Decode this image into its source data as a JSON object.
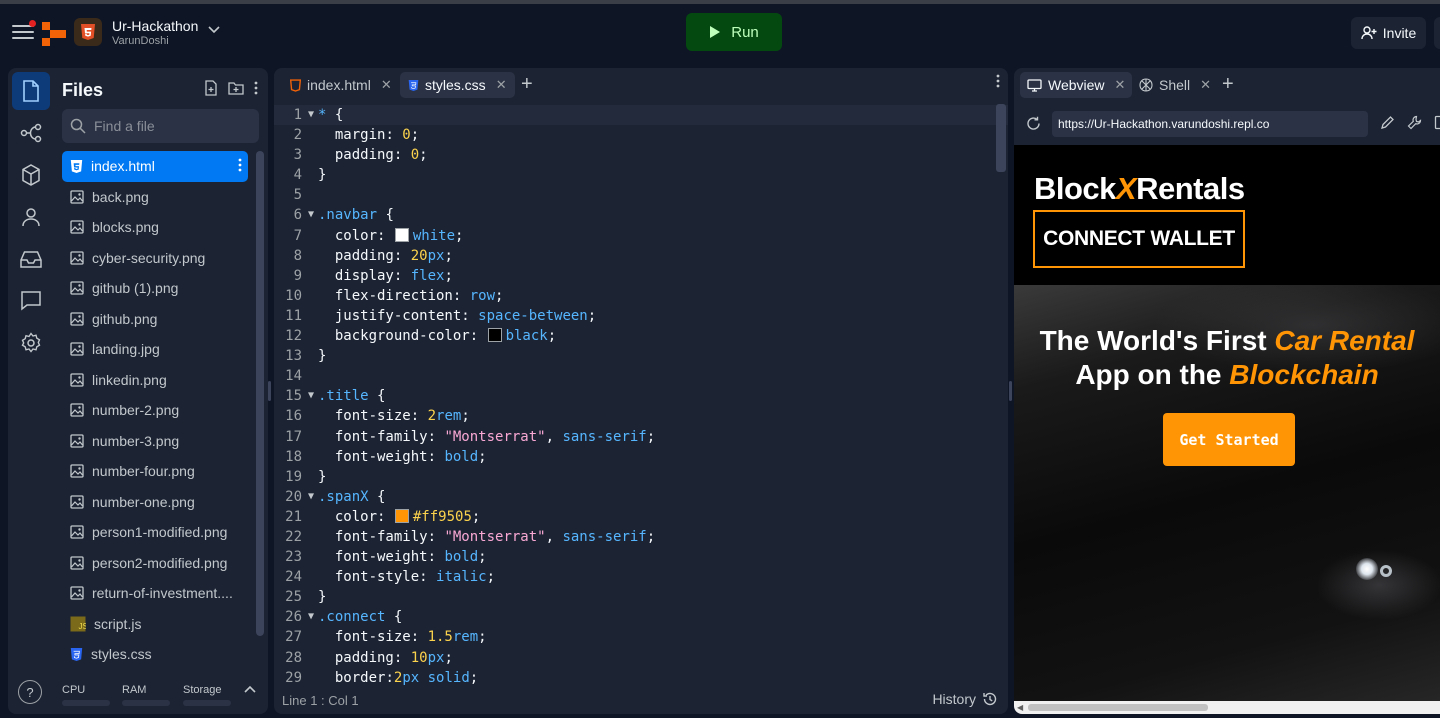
{
  "project": {
    "name": "Ur-Hackathon",
    "owner": "VarunDoshi"
  },
  "topbar": {
    "run_label": "Run",
    "invite_label": "Invite"
  },
  "files_panel": {
    "title": "Files",
    "search_placeholder": "Find a file",
    "files": [
      {
        "name": "index.html",
        "icon": "html-file-icon",
        "active": true
      },
      {
        "name": "back.png",
        "icon": "image-file-icon"
      },
      {
        "name": "blocks.png",
        "icon": "image-file-icon"
      },
      {
        "name": "cyber-security.png",
        "icon": "image-file-icon"
      },
      {
        "name": "github (1).png",
        "icon": "image-file-icon"
      },
      {
        "name": "github.png",
        "icon": "image-file-icon"
      },
      {
        "name": "landing.jpg",
        "icon": "image-file-icon"
      },
      {
        "name": "linkedin.png",
        "icon": "image-file-icon"
      },
      {
        "name": "number-2.png",
        "icon": "image-file-icon"
      },
      {
        "name": "number-3.png",
        "icon": "image-file-icon"
      },
      {
        "name": "number-four.png",
        "icon": "image-file-icon"
      },
      {
        "name": "number-one.png",
        "icon": "image-file-icon"
      },
      {
        "name": "person1-modified.png",
        "icon": "image-file-icon"
      },
      {
        "name": "person2-modified.png",
        "icon": "image-file-icon"
      },
      {
        "name": "return-of-investment....",
        "icon": "image-file-icon"
      },
      {
        "name": "script.js",
        "icon": "js-file-icon"
      },
      {
        "name": "styles.css",
        "icon": "css-file-icon"
      }
    ],
    "resources": {
      "cpu": "CPU",
      "ram": "RAM",
      "storage": "Storage"
    }
  },
  "editor": {
    "tabs": [
      {
        "label": "index.html",
        "icon": "html-file-icon",
        "active": false
      },
      {
        "label": "styles.css",
        "icon": "css-file-icon",
        "active": true
      }
    ],
    "status_position": "Line 1 : Col 1",
    "history_label": "History",
    "lines": [
      {
        "n": 1,
        "fold": true,
        "html": "<span class='t-sel'>*</span> {"
      },
      {
        "n": 2,
        "html": "  <span class='t-prop'>margin</span>: <span class='t-num'>0</span>;"
      },
      {
        "n": 3,
        "html": "  <span class='t-prop'>padding</span>: <span class='t-num'>0</span>;"
      },
      {
        "n": 4,
        "html": "}"
      },
      {
        "n": 5,
        "html": ""
      },
      {
        "n": 6,
        "fold": true,
        "html": "<span class='t-sel'>.navbar</span> {"
      },
      {
        "n": 7,
        "html": "  <span class='t-prop'>color</span>: <span class='swatch' style='background:#ffffff'></span><span class='t-kw'>white</span>;"
      },
      {
        "n": 8,
        "html": "  <span class='t-prop'>padding</span>: <span class='t-num'>20</span><span class='t-unit'>px</span>;"
      },
      {
        "n": 9,
        "html": "  <span class='t-prop'>display</span>: <span class='t-kw'>flex</span>;"
      },
      {
        "n": 10,
        "html": "  <span class='t-prop'>flex-direction</span>: <span class='t-kw'>row</span>;"
      },
      {
        "n": 11,
        "html": "  <span class='t-prop'>justify-content</span>: <span class='t-kw'>space-between</span>;"
      },
      {
        "n": 12,
        "html": "  <span class='t-prop'>background-color</span>: <span class='swatch' style='background:#000000'></span><span class='t-kw'>black</span>;"
      },
      {
        "n": 13,
        "html": "}"
      },
      {
        "n": 14,
        "html": ""
      },
      {
        "n": 15,
        "fold": true,
        "html": "<span class='t-sel'>.title</span> {"
      },
      {
        "n": 16,
        "html": "  <span class='t-prop'>font-size</span>: <span class='t-num'>2</span><span class='t-unit'>rem</span>;"
      },
      {
        "n": 17,
        "html": "  <span class='t-prop'>font-family</span>: <span class='t-str'>\"Montserrat\"</span>, <span class='t-kw'>sans-serif</span>;"
      },
      {
        "n": 18,
        "html": "  <span class='t-prop'>font-weight</span>: <span class='t-kw'>bold</span>;"
      },
      {
        "n": 19,
        "html": "}"
      },
      {
        "n": 20,
        "fold": true,
        "html": "<span class='t-sel'>.spanX</span> {"
      },
      {
        "n": 21,
        "html": "  <span class='t-prop'>color</span>: <span class='swatch' style='background:#ff9505'></span><span class='t-hex'>#ff9505</span>;"
      },
      {
        "n": 22,
        "html": "  <span class='t-prop'>font-family</span>: <span class='t-str'>\"Montserrat\"</span>, <span class='t-kw'>sans-serif</span>;"
      },
      {
        "n": 23,
        "html": "  <span class='t-prop'>font-weight</span>: <span class='t-kw'>bold</span>;"
      },
      {
        "n": 24,
        "html": "  <span class='t-prop'>font-style</span>: <span class='t-kw'>italic</span>;"
      },
      {
        "n": 25,
        "html": "}"
      },
      {
        "n": 26,
        "fold": true,
        "html": "<span class='t-sel'>.connect</span> {"
      },
      {
        "n": 27,
        "html": "  <span class='t-prop'>font-size</span>: <span class='t-num'>1.5</span><span class='t-unit'>rem</span>;"
      },
      {
        "n": 28,
        "html": "  <span class='t-prop'>padding</span>: <span class='t-num'>10</span><span class='t-unit'>px</span>;"
      },
      {
        "n": 29,
        "html": "  <span class='t-prop'>border</span>:<span class='t-num'>2</span><span class='t-unit'>px</span> <span class='t-kw'>solid</span>;"
      }
    ]
  },
  "webview": {
    "tabs": [
      {
        "label": "Webview",
        "icon": "monitor-icon",
        "active": true
      },
      {
        "label": "Shell",
        "icon": "shell-icon",
        "active": false
      }
    ],
    "url": "https://Ur-Hackathon.varundoshi.repl.co",
    "site": {
      "brand_pre": "Block",
      "brand_x": "X",
      "brand_post": "Rentals",
      "connect_label": "CONNECT WALLET",
      "headline_1a": "The World's First ",
      "headline_1b": "Car Rental",
      "headline_2a": "App on the ",
      "headline_2b": "Blockchain",
      "cta_label": "Get Started"
    }
  },
  "colors": {
    "accent": "#0079f2",
    "run_bg": "#044a10",
    "brand_orange": "#ff9505",
    "bg": "#0e1525",
    "surface": "#1c2333"
  }
}
